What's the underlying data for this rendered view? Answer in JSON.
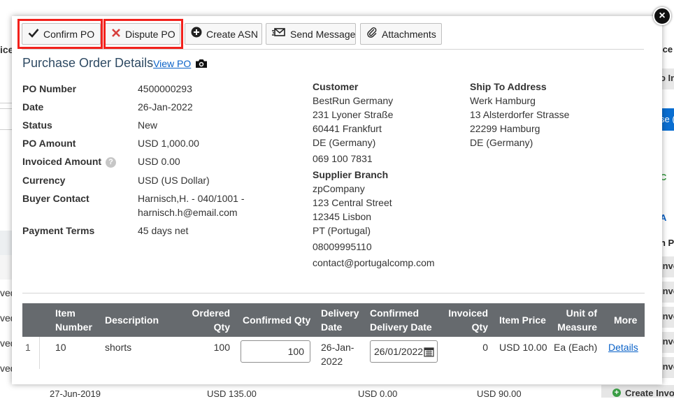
{
  "background": {
    "left_fragments": [
      "ice",
      "ved",
      "ved",
      "ved",
      "ved"
    ],
    "right_fragments": [
      "ice",
      "o In",
      "se (",
      "C",
      "A",
      "n P",
      "Invo",
      "Invo",
      "Invo",
      "Invo",
      "Invo"
    ],
    "bottom_row": {
      "date": "27-Jun-2019",
      "amount": "USD 135.00",
      "invoiced": "USD 0.00",
      "price": "USD 90.00",
      "button": "Create Invo"
    }
  },
  "toolbar": {
    "confirm_label": "Confirm PO",
    "dispute_label": "Dispute PO",
    "create_asn_label": "Create ASN",
    "send_message_label": "Send Message",
    "attachments_label": "Attachments",
    "highlight_color": "#f2211c"
  },
  "header": {
    "title": "Purchase Order Details",
    "view_po_link": "View PO",
    "close_symbol": "×"
  },
  "fields": [
    {
      "label": "PO Number",
      "value": "4500000293"
    },
    {
      "label": "Date",
      "value": "26-Jan-2022"
    },
    {
      "label": "Status",
      "value": "New"
    },
    {
      "label": "PO Amount",
      "value": "USD 1,000.00"
    },
    {
      "label": "Invoiced Amount",
      "value": "USD 0.00"
    },
    {
      "label": "Currency",
      "value": "USD (US Dollar)"
    },
    {
      "label": "Buyer Contact",
      "value": "Harnisch,H. - 040/1001 -",
      "value2": "harnisch.h@email.com"
    },
    {
      "label": "Payment Terms",
      "value": "45 days net"
    }
  ],
  "customer": {
    "heading": "Customer",
    "lines": [
      "BestRun Germany",
      "231 Lyoner Straße",
      "60441 Frankfurt",
      "DE (Germany)"
    ],
    "phone": "069 100 7831"
  },
  "supplier_branch": {
    "heading": "Supplier Branch",
    "lines": [
      "zpCompany",
      "123 Central Street",
      "12345 Lisbon",
      "PT (Portugal)"
    ],
    "phone": "08009995110",
    "email": "contact@portugalcomp.com"
  },
  "ship_to": {
    "heading": "Ship To Address",
    "lines": [
      "Werk Hamburg",
      "13 Alsterdorfer Strasse",
      "22299 Hamburg",
      "DE (Germany)"
    ]
  },
  "table": {
    "headers": {
      "item_number": [
        "Item",
        "Number"
      ],
      "description": "Description",
      "ordered_qty": [
        "Ordered",
        "Qty"
      ],
      "confirmed_qty": "Confirmed Qty",
      "delivery_date": [
        "Delivery",
        "Date"
      ],
      "confirmed_delivery_date": [
        "Confirmed",
        "Delivery Date"
      ],
      "invoiced_qty": [
        "Invoiced",
        "Qty"
      ],
      "item_price": "Item Price",
      "unit_of_measure": [
        "Unit of",
        "Measure"
      ],
      "more": "More"
    },
    "rows": [
      {
        "index": "1",
        "item_number": "10",
        "description": "shorts",
        "ordered_qty": "100",
        "confirmed_qty": "100",
        "delivery_date": [
          "26-Jan-",
          "2022"
        ],
        "confirmed_delivery_date": "26/01/2022",
        "invoiced_qty": "0",
        "item_price": "USD 10.00",
        "unit_of_measure": "Ea (Each)",
        "more": "Details"
      }
    ]
  }
}
